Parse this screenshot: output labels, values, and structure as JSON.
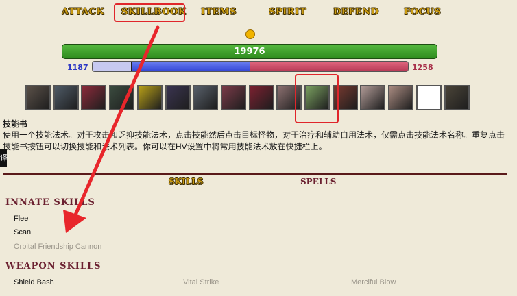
{
  "menu": {
    "items": [
      "ATTACK",
      "SKILLBOOK",
      "ITEMS",
      "SPIRIT",
      "DEFEND",
      "FOCUS"
    ]
  },
  "status": {
    "hp_value": "19976",
    "mp_left": "1187",
    "mp_right": "1258"
  },
  "skill_icons": [
    {
      "name": "skill-icon-1",
      "color": "#5a5048"
    },
    {
      "name": "skill-icon-2",
      "color": "#4e5a66"
    },
    {
      "name": "skill-icon-3",
      "color": "#8a2a3a"
    },
    {
      "name": "skill-icon-4",
      "color": "#3a4a3e"
    },
    {
      "name": "skill-icon-5",
      "color": "#b8a018"
    },
    {
      "name": "skill-icon-6",
      "color": "#3a3450"
    },
    {
      "name": "skill-icon-7",
      "color": "#58606a"
    },
    {
      "name": "skill-icon-8",
      "color": "#7a3a48"
    },
    {
      "name": "skill-icon-9",
      "color": "#7a2030"
    },
    {
      "name": "skill-icon-10",
      "color": "#8c7070"
    },
    {
      "name": "skill-icon-11",
      "color": "#7aa060"
    },
    {
      "name": "skill-icon-12",
      "color": "#7a3a30"
    },
    {
      "name": "skill-icon-13",
      "color": "#b09a96"
    },
    {
      "name": "skill-icon-14",
      "color": "#a88a80"
    },
    {
      "name": "skill-icon-15",
      "color": "#ffffff"
    },
    {
      "name": "skill-icon-16",
      "color": "#4a4438"
    }
  ],
  "description": {
    "title": "技能书",
    "text": "使用一个技能法术。对于攻击和乏抑技能法术，点击技能然后点击目标怪物，对于治疗和辅助自用法术，仅需点击技能法术名称。重复点击技能书按钮可以切换技能和法术列表。你可以在HV设置中将常用技能法术放在快捷栏上。",
    "side_label": "译"
  },
  "subtabs": [
    "SKILLS",
    "SPELLS"
  ],
  "sections": {
    "innate": {
      "title": "INNATE SKILLS",
      "skills": [
        "Flee",
        "Scan",
        "Orbital Friendship Cannon"
      ]
    },
    "weapon": {
      "title": "WEAPON SKILLS",
      "skills": [
        "Shield Bash",
        "Vital Strike",
        "Merciful Blow"
      ]
    }
  },
  "colors": {
    "highlight": "#e0262b",
    "accent_gold": "#c99a12",
    "section_maroon": "#6b2030"
  }
}
